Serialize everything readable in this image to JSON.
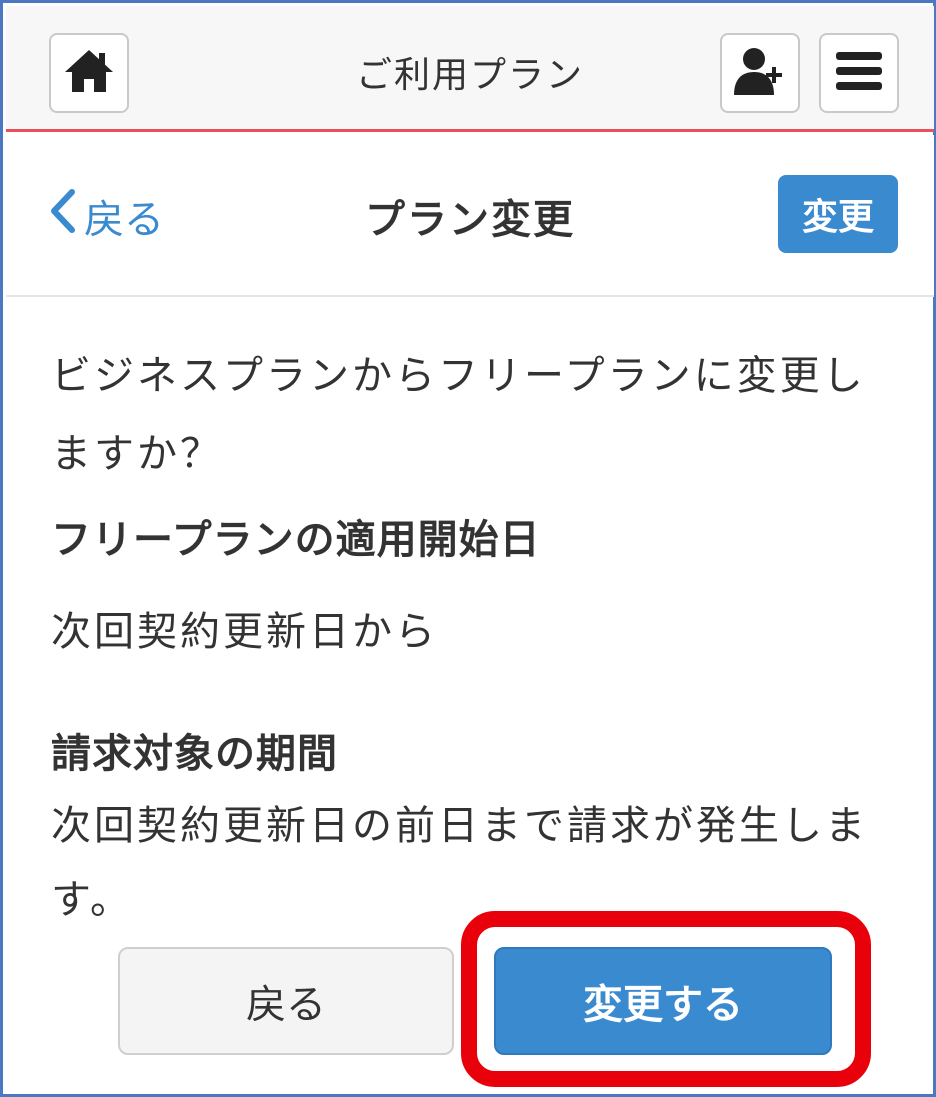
{
  "header": {
    "title": "ご利用プラン",
    "home_icon": "home-icon",
    "add_user_icon": "add-user-icon",
    "menu_icon": "hamburger-menu-icon"
  },
  "subheader": {
    "back_label": "戻る",
    "title": "プラン変更",
    "action_label": "変更"
  },
  "content": {
    "question": "ビジネスプランからフリープランに変更しますか？",
    "sections": [
      {
        "heading": "フリープランの適用開始日",
        "text": "次回契約更新日から"
      },
      {
        "heading": "請求対象の期間",
        "text": "次回契約更新日の前日まで請求が発生します。"
      }
    ]
  },
  "footer": {
    "back_button_label": "戻る",
    "change_button_label": "変更する"
  },
  "colors": {
    "accent": "#3a8ad0",
    "header_rule": "#e8505b",
    "highlight": "#e8000b"
  }
}
